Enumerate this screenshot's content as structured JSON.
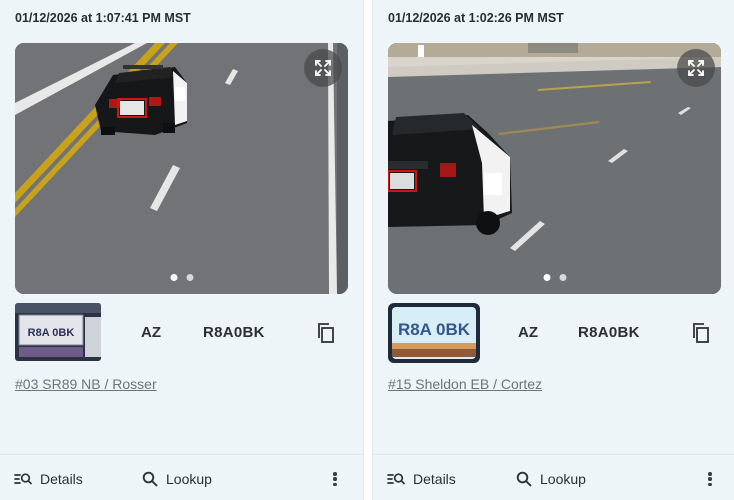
{
  "cards": [
    {
      "timestamp": "01/12/2026 at 1:07:41 PM MST",
      "plate_thumb_text": "R8A 0BK",
      "state": "AZ",
      "plate": "R8A0BK",
      "camera": "#03 SR89 NB / Rosser",
      "details_label": "Details",
      "lookup_label": "Lookup",
      "image_index": 1,
      "image_count": 2
    },
    {
      "timestamp": "01/12/2026 at 1:02:26 PM MST",
      "plate_thumb_text": "R8A 0BK",
      "state": "AZ",
      "plate": "R8A0BK",
      "camera": "#15 Sheldon EB / Cortez",
      "details_label": "Details",
      "lookup_label": "Lookup",
      "image_index": 1,
      "image_count": 2
    }
  ],
  "icons": {
    "expand": "expand-icon",
    "copy": "copy-icon",
    "details": "details-list-icon",
    "lookup": "search-icon",
    "more": "more-vertical-icon"
  },
  "colors": {
    "card_bg": "#eef5f9",
    "link": "#6d7478",
    "text": "#2b2f33"
  }
}
